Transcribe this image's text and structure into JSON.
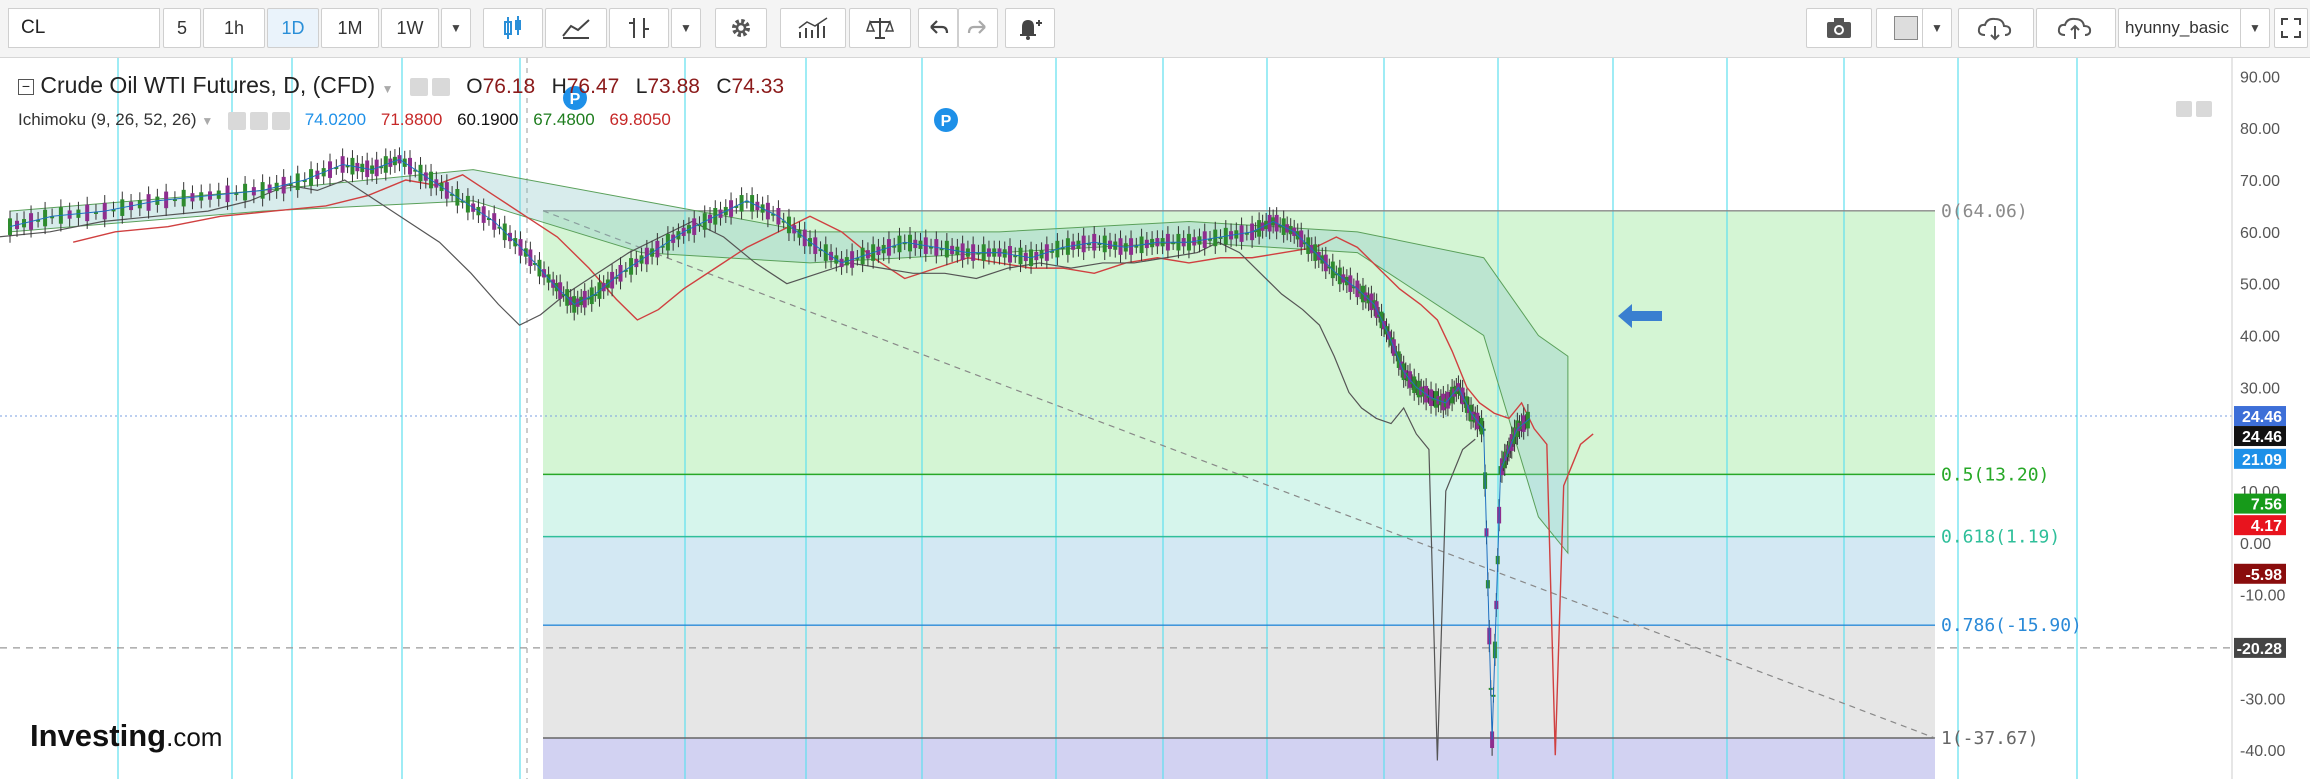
{
  "toolbar": {
    "symbol": "CL",
    "intervals": [
      "5",
      "1h",
      "1D",
      "1M",
      "1W"
    ],
    "active_interval": "1D",
    "user_template": "hyunny_basic"
  },
  "legend": {
    "title": "Crude Oil WTI Futures, D, (CFD)",
    "open_label": "O",
    "open": "76.18",
    "high_label": "H",
    "high": "76.47",
    "low_label": "L",
    "low": "73.88",
    "close_label": "C",
    "close": "74.33",
    "indicator": "Ichimoku (9, 26, 52, 26)",
    "ichimoku_values": [
      "74.0200",
      "71.8800",
      "60.1900",
      "67.4800",
      "69.8050"
    ]
  },
  "logo": {
    "brand": "Investing",
    "suffix": ".com"
  },
  "colors": {
    "price_tag_blue": "#3d6fd8",
    "price_tag_black": "#111111",
    "price_tag_azure": "#1e90e8",
    "price_tag_green": "#179a1a",
    "price_tag_red": "#e8141e",
    "price_tag_darkred": "#8a0d0d",
    "price_tag_gray": "#444444",
    "fib_green": "#27a827",
    "fib_teal": "#2fbf9a",
    "fib_blue": "#2a8ad8",
    "fib_gray": "#666666",
    "grid_cyan": "#5fe0ee",
    "tenkan": "#d04040",
    "kijun": "#8b1a1a",
    "chikou": "#555555",
    "arrow": "#3a7fd0"
  },
  "markers": [
    "P",
    "P"
  ],
  "chart_data": {
    "type": "candlestick",
    "ylim": [
      -45,
      92
    ],
    "yticks": [
      "90.00",
      "80.00",
      "70.00",
      "60.00",
      "50.00",
      "40.00",
      "30.00",
      "20.00",
      "10.00",
      "0.00",
      "-10.00",
      "-20.00",
      "-30.00",
      "-40.00"
    ],
    "ytick_values": [
      90,
      80,
      70,
      60,
      50,
      40,
      30,
      20,
      10,
      0,
      -10,
      -20,
      -30,
      -40
    ],
    "fibonacci": {
      "levels": [
        {
          "label": "0(64.06)",
          "value": 64.06,
          "color": "#8a8a8a"
        },
        {
          "label": "0.5(13.20)",
          "value": 13.2,
          "color": "#27a827"
        },
        {
          "label": "0.618(1.19)",
          "value": 1.19,
          "color": "#2fbf9a"
        },
        {
          "label": "0.786(-15.90)",
          "value": -15.9,
          "color": "#2a8ad8"
        },
        {
          "label": "1(-37.67)",
          "value": -37.67,
          "color": "#666666"
        }
      ]
    },
    "price_tags": [
      {
        "label": "24.46",
        "value": 24.46,
        "color": "#3d6fd8"
      },
      {
        "label": "24.46",
        "value": 20.6,
        "color": "#111111"
      },
      {
        "label": "21.09",
        "value": 16.2,
        "color": "#1e90e8"
      },
      {
        "label": "7.56",
        "value": 7.56,
        "color": "#179a1a"
      },
      {
        "label": "4.17",
        "value": 3.4,
        "color": "#e8141e"
      },
      {
        "label": "-5.98",
        "value": -5.98,
        "color": "#8a0d0d"
      },
      {
        "label": "-20.28",
        "value": -20.28,
        "color": "#444444"
      }
    ],
    "close_path": [
      [
        0,
        61
      ],
      [
        20,
        63
      ],
      [
        45,
        64
      ],
      [
        70,
        66
      ],
      [
        95,
        67
      ],
      [
        120,
        68
      ],
      [
        140,
        70
      ],
      [
        158,
        73
      ],
      [
        172,
        72
      ],
      [
        185,
        74
      ],
      [
        200,
        70
      ],
      [
        215,
        66
      ],
      [
        230,
        62
      ],
      [
        245,
        56
      ],
      [
        258,
        50
      ],
      [
        268,
        46
      ],
      [
        278,
        48
      ],
      [
        290,
        52
      ],
      [
        305,
        56
      ],
      [
        320,
        60
      ],
      [
        335,
        63
      ],
      [
        350,
        66
      ],
      [
        365,
        63
      ],
      [
        380,
        58
      ],
      [
        395,
        54
      ],
      [
        410,
        56
      ],
      [
        425,
        58
      ],
      [
        440,
        57
      ],
      [
        455,
        56
      ],
      [
        470,
        56
      ],
      [
        485,
        55
      ],
      [
        500,
        57
      ],
      [
        515,
        58
      ],
      [
        530,
        57
      ],
      [
        545,
        58
      ],
      [
        560,
        58
      ],
      [
        575,
        59
      ],
      [
        590,
        60
      ],
      [
        600,
        62
      ],
      [
        610,
        60
      ],
      [
        620,
        56
      ],
      [
        630,
        52
      ],
      [
        640,
        49
      ],
      [
        648,
        46
      ],
      [
        655,
        40
      ],
      [
        662,
        33
      ],
      [
        668,
        30
      ],
      [
        675,
        28
      ],
      [
        682,
        27
      ],
      [
        688,
        30
      ],
      [
        694,
        25
      ],
      [
        700,
        22
      ],
      [
        704,
        -38
      ],
      [
        708,
        14
      ],
      [
        712,
        18
      ],
      [
        716,
        22
      ],
      [
        722,
        24
      ]
    ]
  }
}
